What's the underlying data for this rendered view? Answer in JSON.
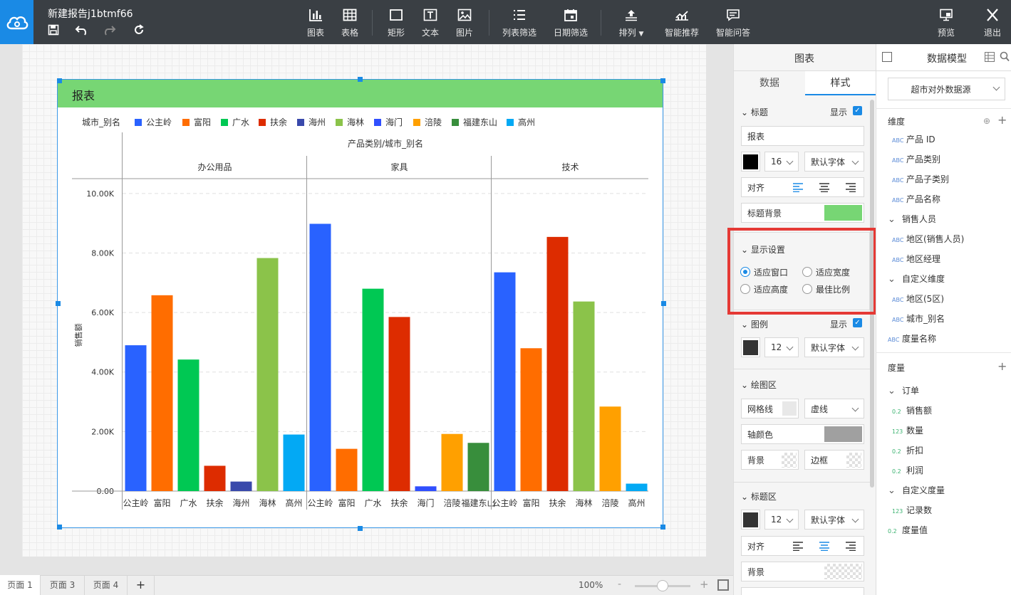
{
  "app": {
    "title": "新建报告j1btmf66"
  },
  "toolbar": {
    "tools": [
      {
        "label": "图表",
        "icon": "bar-chart-icon"
      },
      {
        "label": "表格",
        "icon": "table-icon"
      },
      {
        "label": "矩形",
        "icon": "rectangle-icon"
      },
      {
        "label": "文本",
        "icon": "text-icon"
      },
      {
        "label": "图片",
        "icon": "image-icon"
      },
      {
        "label": "列表筛选",
        "icon": "list-filter-icon"
      },
      {
        "label": "日期筛选",
        "icon": "calendar-icon"
      },
      {
        "label": "排列",
        "icon": "arrange-icon"
      },
      {
        "label": "智能推荐",
        "icon": "smart-recommend-icon"
      },
      {
        "label": "智能问答",
        "icon": "chat-icon"
      }
    ],
    "preview": "预览",
    "exit": "退出"
  },
  "chart_widget": {
    "header_title": "报表",
    "header_color": "#77d674",
    "legend_title": "城市_别名"
  },
  "chart_data": {
    "type": "bar",
    "title": "报表",
    "column_header": "产品类别/城市_别名",
    "ylabel": "销售额",
    "ylim": [
      0,
      11000
    ],
    "yticks": [
      "0.00",
      "2.00K",
      "4.00K",
      "6.00K",
      "8.00K",
      "10.00K"
    ],
    "ytick_values": [
      0,
      2000,
      4000,
      6000,
      8000,
      10000
    ],
    "grid": "dashed",
    "legend": [
      {
        "name": "公主岭",
        "color": "#2962ff"
      },
      {
        "name": "富阳",
        "color": "#ff6d00"
      },
      {
        "name": "广水",
        "color": "#00c853"
      },
      {
        "name": "扶余",
        "color": "#dd2c00"
      },
      {
        "name": "海州",
        "color": "#3949ab"
      },
      {
        "name": "海林",
        "color": "#8bc34a"
      },
      {
        "name": "海门",
        "color": "#304ffe"
      },
      {
        "name": "涪陵",
        "color": "#ffa000"
      },
      {
        "name": "福建东山",
        "color": "#388e3c"
      },
      {
        "name": "高州",
        "color": "#03a9f4"
      }
    ],
    "groups": [
      {
        "category": "办公用品",
        "bars": [
          {
            "city": "公主岭",
            "value": 4900
          },
          {
            "city": "富阳",
            "value": 6580
          },
          {
            "city": "广水",
            "value": 4420
          },
          {
            "city": "扶余",
            "value": 850
          },
          {
            "city": "海州",
            "value": 320
          },
          {
            "city": "海林",
            "value": 7830
          },
          {
            "city": "高州",
            "value": 1900
          }
        ]
      },
      {
        "category": "家具",
        "bars": [
          {
            "city": "公主岭",
            "value": 8980
          },
          {
            "city": "富阳",
            "value": 1420
          },
          {
            "city": "广水",
            "value": 6800
          },
          {
            "city": "扶余",
            "value": 5850
          },
          {
            "city": "海门",
            "value": 160
          },
          {
            "city": "涪陵",
            "value": 1920
          },
          {
            "city": "福建东山",
            "value": 1620
          }
        ]
      },
      {
        "category": "技术",
        "bars": [
          {
            "city": "公主岭",
            "value": 7350
          },
          {
            "city": "富阳",
            "value": 4800
          },
          {
            "city": "扶余",
            "value": 8540
          },
          {
            "city": "海林",
            "value": 6370
          },
          {
            "city": "涪陵",
            "value": 2840
          },
          {
            "city": "高州",
            "value": 250
          }
        ]
      }
    ]
  },
  "page_tabs": [
    "页面 1",
    "页面 3",
    "页面 4",
    "+"
  ],
  "zoom": {
    "value": "100%",
    "minus": "-",
    "plus": "+",
    "level": 0.5
  },
  "style_panel": {
    "header": "图表",
    "tabs": [
      "数据",
      "样式"
    ],
    "active_tab": "样式",
    "title_section": {
      "label": "标题",
      "show_label": "显示",
      "text": "报表",
      "color": "#000000",
      "font_size": "16",
      "font_family": "默认字体",
      "align_label": "对齐",
      "bg_label": "标题背景",
      "bg_color": "#77d674"
    },
    "display_section": {
      "label": "显示设置",
      "options": [
        "适应窗口",
        "适应宽度",
        "适应高度",
        "最佳比例"
      ],
      "selected": "适应窗口"
    },
    "legend_section": {
      "label": "图例",
      "show_label": "显示",
      "color": "#333333",
      "font_size": "12",
      "font_family": "默认字体"
    },
    "plot_section": {
      "label": "绘图区",
      "grid_label": "网格线",
      "grid_style": "虚线",
      "axis_color_label": "轴颜色",
      "axis_color": "#a0a0a0",
      "bg_label": "背景",
      "border_label": "边框"
    },
    "title_area_section": {
      "label": "标题区",
      "color": "#333333",
      "font_size": "12",
      "font_family": "默认字体",
      "align_label": "对齐",
      "bg_label": "背景"
    }
  },
  "model_panel": {
    "header": "数据模型",
    "datasource": "超市对外数据源",
    "dimension_label": "维度",
    "dimensions": [
      {
        "tag": "ABC",
        "name": "产品 ID",
        "level": 1
      },
      {
        "tag": "ABC",
        "name": "产品类别",
        "level": 1
      },
      {
        "tag": "ABC",
        "name": "产品子类别",
        "level": 1
      },
      {
        "tag": "ABC",
        "name": "产品名称",
        "level": 1
      },
      {
        "tag": "",
        "name": "销售人员",
        "level": 0,
        "folder": true
      },
      {
        "tag": "ABC",
        "name": "地区(销售人员)",
        "level": 1
      },
      {
        "tag": "ABC",
        "name": "地区经理",
        "level": 1
      },
      {
        "tag": "",
        "name": "自定义维度",
        "level": 0,
        "folder": true
      },
      {
        "tag": "ABC",
        "name": "地区(5区)",
        "level": 1
      },
      {
        "tag": "ABC",
        "name": "城市_别名",
        "level": 1
      },
      {
        "tag": "ABC",
        "name": "度量名称",
        "level": 0
      }
    ],
    "measure_label": "度量",
    "measures": [
      {
        "tag": "",
        "name": "订单",
        "level": 0,
        "folder": true
      },
      {
        "tag": "0.2",
        "name": "销售额",
        "level": 1
      },
      {
        "tag": "123",
        "name": "数量",
        "level": 1
      },
      {
        "tag": "0.2",
        "name": "折扣",
        "level": 1
      },
      {
        "tag": "0.2",
        "name": "利润",
        "level": 1
      },
      {
        "tag": "",
        "name": "自定义度量",
        "level": 0,
        "folder": true
      },
      {
        "tag": "123",
        "name": "记录数",
        "level": 1
      },
      {
        "tag": "0.2",
        "name": "度量值",
        "level": 0
      }
    ]
  }
}
